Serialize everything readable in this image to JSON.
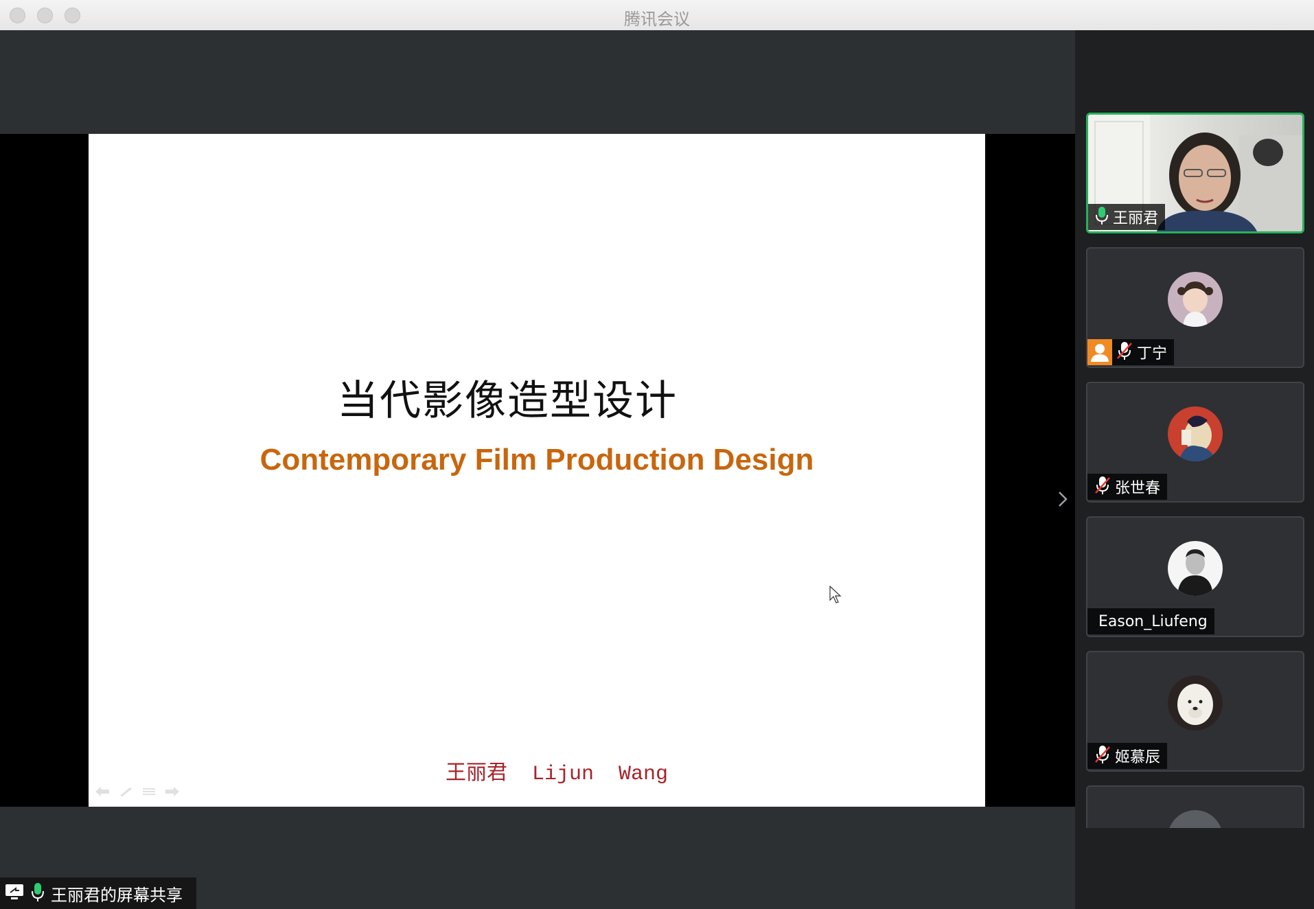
{
  "window": {
    "title": "腾讯会议"
  },
  "slide": {
    "title_cn": "当代影像造型设计",
    "title_en": "Contemporary Film Production Design",
    "author": "王丽君  Lijun  Wang"
  },
  "share_status": {
    "label": "王丽君的屏幕共享"
  },
  "participants": [
    {
      "name": "王丽君",
      "mic": "on",
      "video": true,
      "active": true
    },
    {
      "name": "丁宁",
      "mic": "muted",
      "video": false,
      "badge": "user-icon"
    },
    {
      "name": "张世春",
      "mic": "muted",
      "video": false
    },
    {
      "name": "Eason_Liufeng",
      "mic": "none",
      "video": false
    },
    {
      "name": "姬慕辰",
      "mic": "muted",
      "video": false
    }
  ],
  "colors": {
    "accent_active": "#25b35a",
    "slide_en_title": "#c8660e",
    "slide_author": "#a6242a",
    "badge_orange": "#f08a24",
    "muted_red": "#e53935"
  }
}
